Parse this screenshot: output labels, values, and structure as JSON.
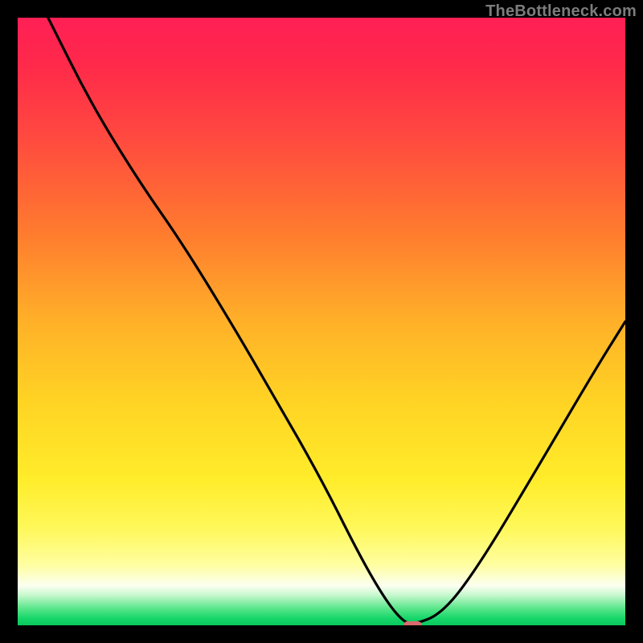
{
  "watermark": "TheBottleneck.com",
  "colors": {
    "frame": "#000000",
    "curve": "#000000",
    "marker": "#d96a6e"
  },
  "chart_data": {
    "type": "line",
    "title": "",
    "xlabel": "",
    "ylabel": "",
    "xlim": [
      0,
      100
    ],
    "ylim": [
      0,
      100
    ],
    "grid": false,
    "legend": false,
    "note": "No numeric axis ticks or labels are rendered; values are positional estimates (0–100) read from the plot area.",
    "series": [
      {
        "name": "bottleneck-curve",
        "x": [
          5,
          12,
          20,
          27,
          35,
          42,
          50,
          56,
          60,
          63,
          65,
          70,
          76,
          85,
          95,
          100
        ],
        "y": [
          100,
          86,
          73,
          63,
          50,
          38,
          24,
          12,
          5,
          1,
          0,
          2,
          10,
          25,
          42,
          50
        ]
      }
    ],
    "marker": {
      "x": 65,
      "y": 0,
      "width_pct": 3.0,
      "height_pct": 1.3
    }
  }
}
